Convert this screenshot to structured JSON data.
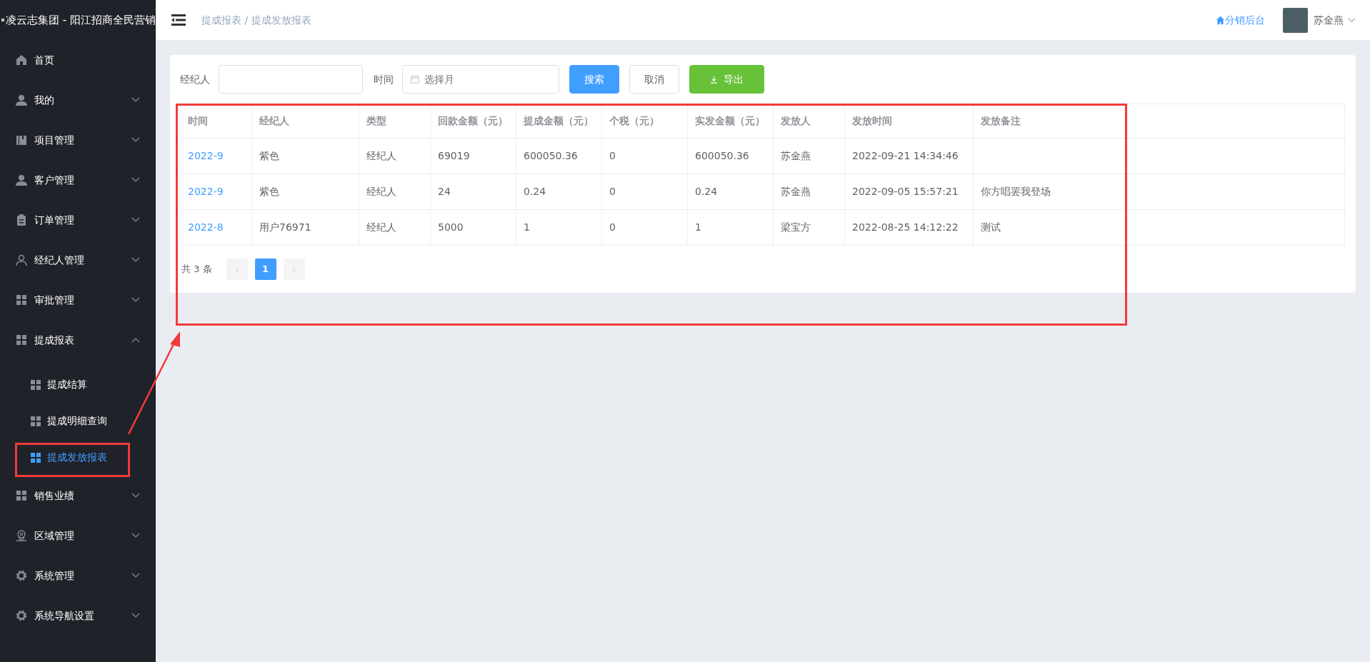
{
  "sidebar": {
    "title": "凌云志集团 - 阳江招商全民营销",
    "items": [
      {
        "label": "首页"
      },
      {
        "label": "我的",
        "expanded": false
      },
      {
        "label": "项目管理",
        "expanded": false
      },
      {
        "label": "客户管理",
        "expanded": false
      },
      {
        "label": "订单管理",
        "expanded": false
      },
      {
        "label": "经纪人管理",
        "expanded": false
      },
      {
        "label": "审批管理",
        "expanded": false
      },
      {
        "label": "提成报表",
        "expanded": true,
        "children": [
          {
            "label": "提成结算",
            "selected": false
          },
          {
            "label": "提成明细查询",
            "selected": false
          },
          {
            "label": "提成发放报表",
            "selected": true
          }
        ]
      },
      {
        "label": "销售业绩",
        "expanded": false
      },
      {
        "label": "区域管理",
        "expanded": false
      },
      {
        "label": "系统管理",
        "expanded": false
      },
      {
        "label": "系统导航设置",
        "expanded": false
      }
    ]
  },
  "header": {
    "breadcrumb": [
      "提成报表",
      "提成发放报表"
    ],
    "separator": "/",
    "link": "分销后台",
    "user": "苏金燕"
  },
  "filters": {
    "agent_label": "经纪人",
    "time_label": "时间",
    "time_placeholder": "选择月",
    "buttons": [
      {
        "label": "搜索",
        "kind": "primary"
      },
      {
        "label": "取消",
        "kind": "plain"
      },
      {
        "label": "导出",
        "kind": "success"
      }
    ]
  },
  "table": {
    "columns": [
      "时间",
      "经纪人",
      "类型",
      "回款金额（元）",
      "提成金额（元）",
      "个税（元）",
      "实发金额（元）",
      "发放人",
      "发放时间",
      "发放备注"
    ],
    "rows": [
      [
        "2022-9",
        "紫色",
        "经纪人",
        "69019",
        "600050.36",
        "0",
        "600050.36",
        "苏金燕",
        "2022-09-21 14:34:46",
        ""
      ],
      [
        "2022-9",
        "紫色",
        "经纪人",
        "24",
        "0.24",
        "0",
        "0.24",
        "苏金燕",
        "2022-09-05 15:57:21",
        "你方唱罢我登场"
      ],
      [
        "2022-8",
        "用户76971",
        "经纪人",
        "5000",
        "1",
        "0",
        "1",
        "梁宝方",
        "2022-08-25 14:12:22",
        "测试"
      ]
    ]
  },
  "pagination": {
    "total": "共 3 条",
    "pages": [
      {
        "label": "1",
        "selected": true
      }
    ]
  }
}
